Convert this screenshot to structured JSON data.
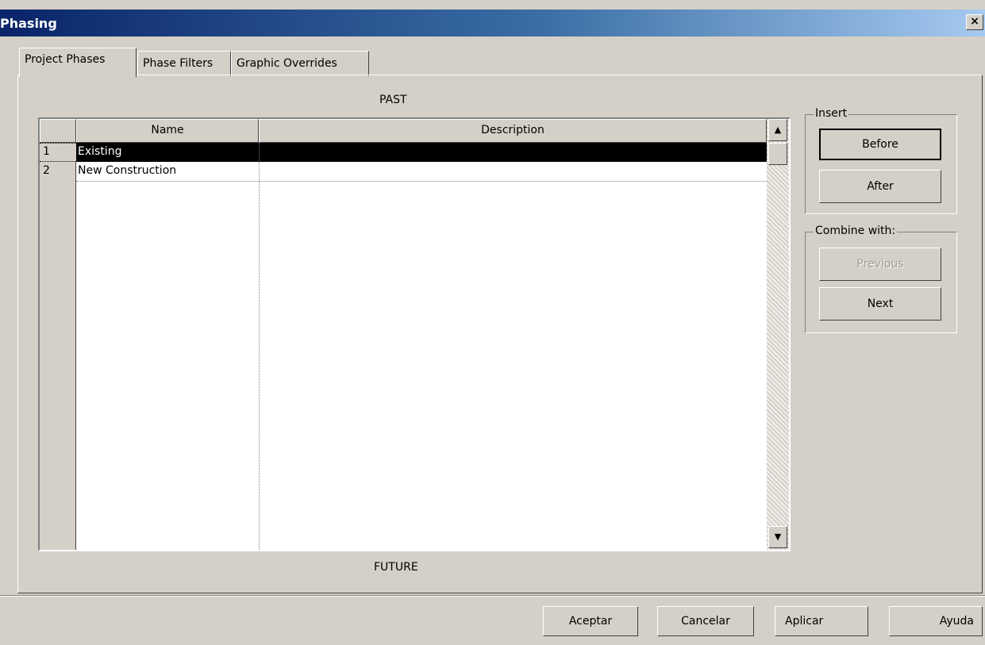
{
  "window": {
    "title": "Phasing",
    "close_label": "×"
  },
  "tabs": [
    {
      "label": "Project Phases",
      "active": true
    },
    {
      "label": "Phase Filters",
      "active": false
    },
    {
      "label": "Graphic Overrides",
      "active": false
    }
  ],
  "labels": {
    "past": "PAST",
    "future": "FUTURE"
  },
  "table": {
    "columns": [
      "Name",
      "Description"
    ],
    "rows": [
      {
        "num": "1",
        "name": "Existing",
        "description": "",
        "selected": true
      },
      {
        "num": "2",
        "name": "New Construction",
        "description": "",
        "selected": false
      }
    ]
  },
  "scrollbar": {
    "up_icon": "▲",
    "down_icon": "▼"
  },
  "insert_group": {
    "legend": "Insert",
    "before": "Before",
    "after": "After"
  },
  "combine_group": {
    "legend": "Combine with:",
    "previous": "Previous",
    "next": "Next"
  },
  "footer": {
    "ok": "Aceptar",
    "cancel": "Cancelar",
    "apply": "Aplicar",
    "help": "Ayuda"
  }
}
